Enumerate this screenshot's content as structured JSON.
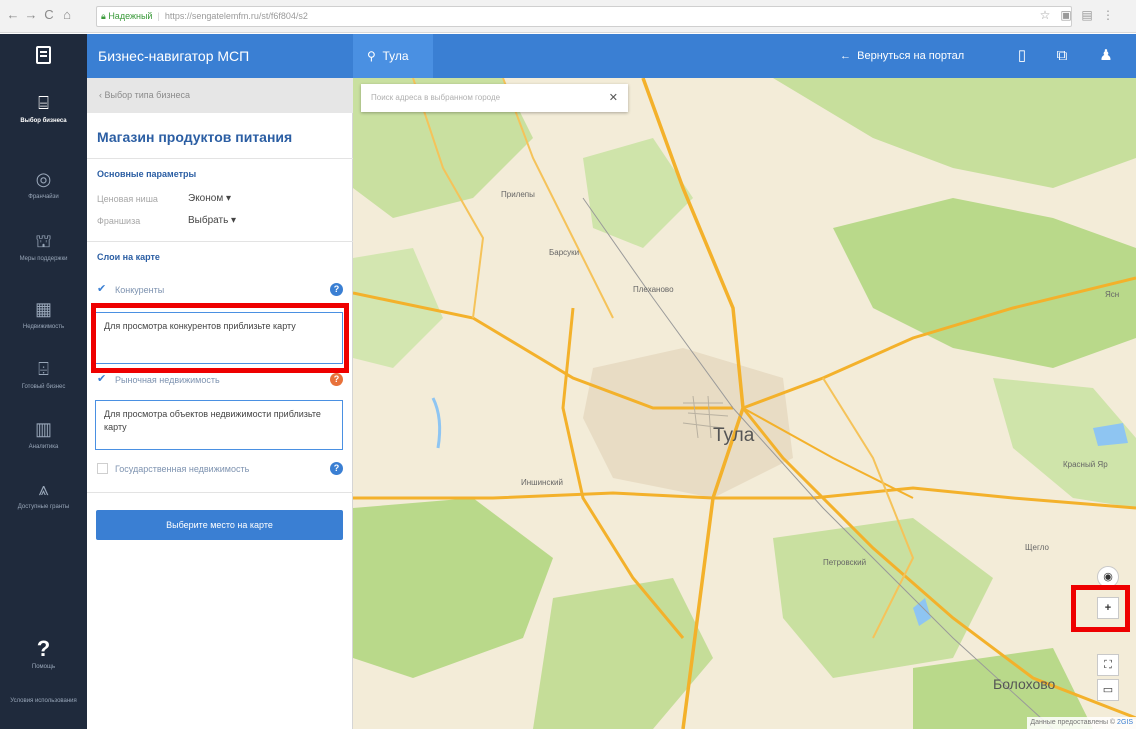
{
  "browser": {
    "nav_icons": [
      "←",
      "→",
      "C",
      "⌂"
    ],
    "secure_label": "Надежный",
    "url": "https://sengatelemfm.ru/st/f6f804/s2",
    "right_icons": [
      "☆",
      "▣",
      "▤",
      "⋮"
    ]
  },
  "header": {
    "app_title": "Бизнес-навигатор МСП",
    "city": "Тула",
    "back_to_portal": "Вернуться на портал"
  },
  "left_nav": {
    "items": [
      {
        "label": "Выбор бизнеса",
        "icon": "briefcase-icon",
        "glyph": "⌸",
        "active": true
      },
      {
        "label": "Франчайзи",
        "icon": "circle-icon",
        "glyph": "◎",
        "active": false
      },
      {
        "label": "Меры поддержки",
        "icon": "people-icon",
        "glyph": "⛫",
        "active": false
      },
      {
        "label": "Недвижимость",
        "icon": "building-icon",
        "glyph": "▦",
        "active": false
      },
      {
        "label": "Готовый бизнес",
        "icon": "shop-icon",
        "glyph": "⌹",
        "active": false
      },
      {
        "label": "Аналитика",
        "icon": "chart-icon",
        "glyph": "▥",
        "active": false
      },
      {
        "label": "Доступные гранты",
        "icon": "road-icon",
        "glyph": "⩓",
        "active": false
      }
    ],
    "help_label": "Помощь",
    "terms_label": "Условия использования"
  },
  "panel": {
    "back_link": "‹ Выбор типа бизнеса",
    "title": "Магазин продуктов питания",
    "main_params_heading": "Основные параметры",
    "price_niche_label": "Ценовая ниша",
    "price_niche_value": "Эконом ▾",
    "franchise_label": "Франшиза",
    "franchise_value": "Выбрать ▾",
    "map_layers_heading": "Слои на карте",
    "layers": [
      {
        "label": "Конкуренты",
        "checked": true,
        "help_color": "#3a7fd3"
      },
      {
        "label": "Рыночная недвижимость",
        "checked": true,
        "help_color": "#e8713a"
      },
      {
        "label": "Государственная недвижимость",
        "checked": false,
        "help_color": "#3a7fd3"
      }
    ],
    "competitors_hint": "Для просмотра конкурентов приблизьте карту",
    "realestate_hint": "Для просмотра объектов недвижимости приблизьте карту",
    "cta_button": "Выберите место на карте"
  },
  "map": {
    "search_placeholder": "Поиск адреса в выбранном городе",
    "city_label": "Тула",
    "place_labels": [
      "Прилепы",
      "Барсуки",
      "Плеханово",
      "Иншинский",
      "Красный Яр",
      "Петровский",
      "Болохово",
      "Щегло",
      "Ясн"
    ],
    "zoom_in": "+",
    "attribution_text": "Данные предоставлены ©",
    "attribution_brand": "2GIS"
  },
  "colors": {
    "header_blue": "#3a7fd3",
    "nav_dark": "#1f2a3c",
    "highlight_red": "#ee0000",
    "map_road": "#f3b12b",
    "map_forest": "#b9d98a"
  }
}
